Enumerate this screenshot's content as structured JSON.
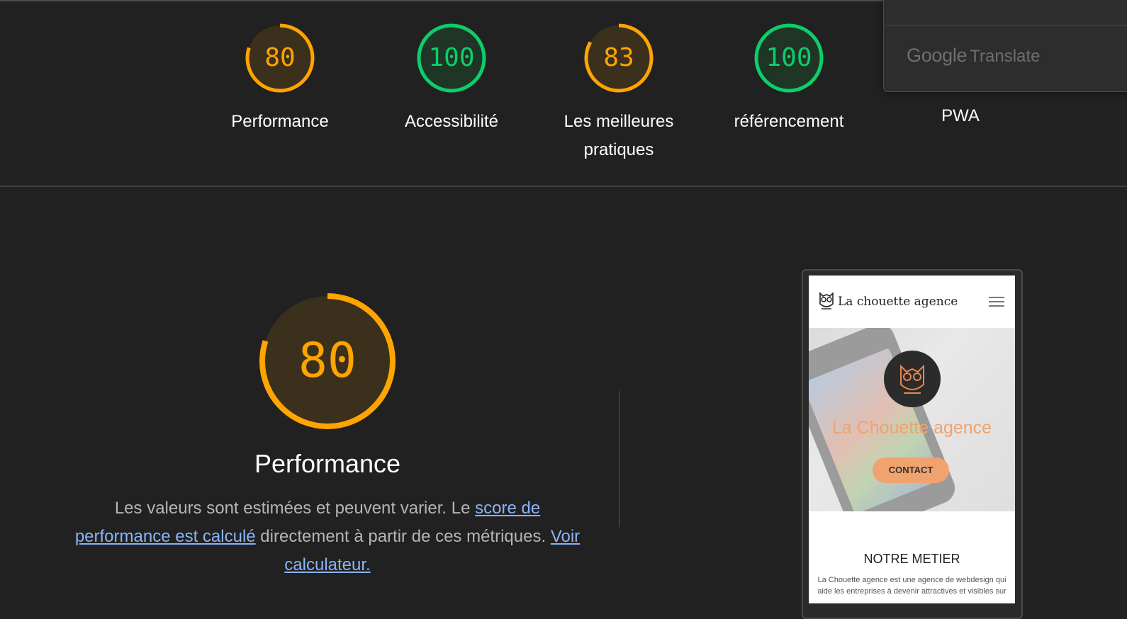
{
  "scores": [
    {
      "value": "80",
      "label": "Performance",
      "fraction": 0.8,
      "color": "#ffa400"
    },
    {
      "value": "100",
      "label": "Accessibilité",
      "fraction": 1.0,
      "color": "#0cce6b"
    },
    {
      "value": "83",
      "label": "Les meilleures pratiques",
      "fraction": 0.83,
      "color": "#ffa400"
    },
    {
      "value": "100",
      "label": "référencement",
      "fraction": 1.0,
      "color": "#0cce6b"
    }
  ],
  "pwa_label": "PWA",
  "translate_popup": {
    "brand_google": "Google",
    "brand_translate": "Translate"
  },
  "performance_section": {
    "score": "80",
    "fraction": 0.8,
    "title": "Performance",
    "description_prefix": "Les valeurs sont estimées et peuvent varier. Le ",
    "link_score": "score de performance est calculé",
    "description_middle": " directement à partir de ces métriques. ",
    "link_calculator": "Voir calculateur."
  },
  "screenshot_preview": {
    "brand": "La chouette agence",
    "hero_title": "La Chouette agence",
    "contact_button": "CONTACT",
    "section_title": "NOTRE METIER",
    "section_text": "La Chouette agence est une agence de webdesign qui aide les entreprises à devenir attractives et visibles sur"
  },
  "colors": {
    "average": "#ffa400",
    "pass": "#0cce6b",
    "average_bg": "#3b301c",
    "pass_bg": "#1f3526",
    "background": "#212121",
    "link": "#8ab4f8"
  }
}
